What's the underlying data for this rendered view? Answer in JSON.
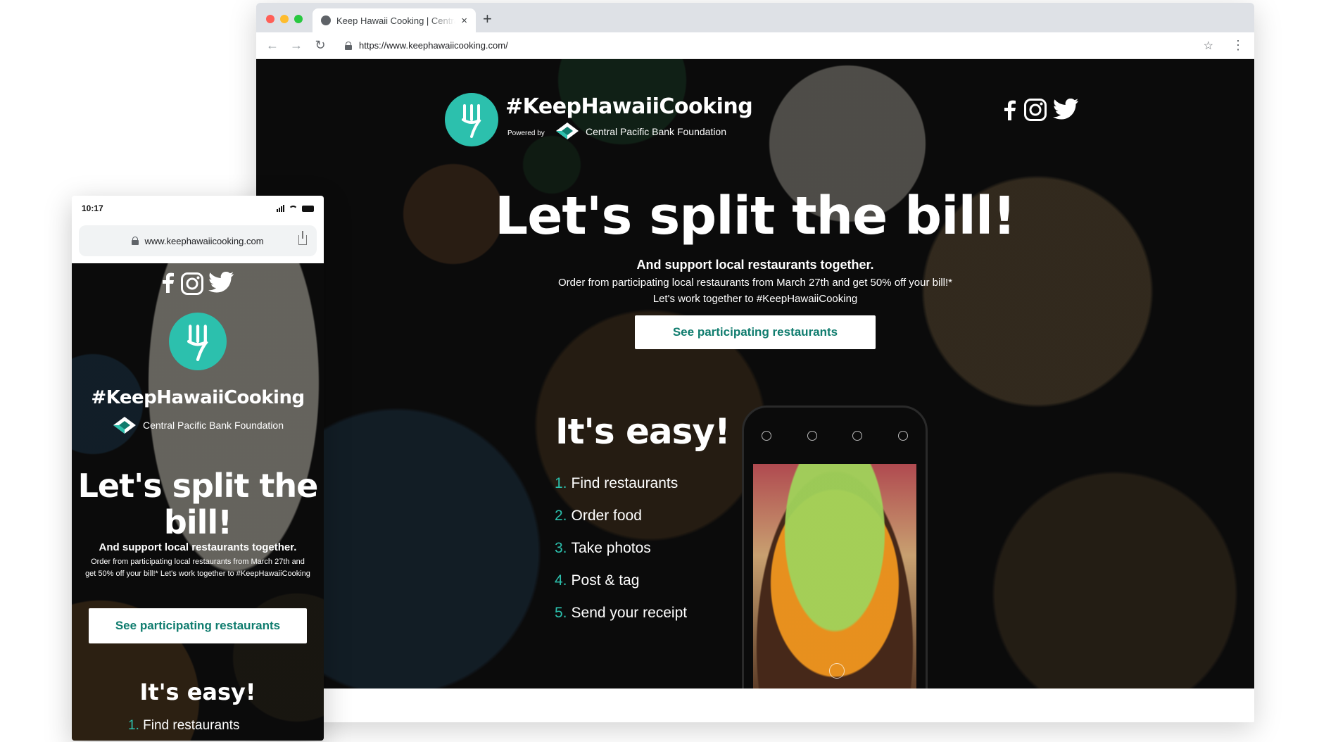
{
  "desktop": {
    "browser": {
      "tab_title": "Keep Hawaii Cooking | Central Pacific Bank Foundation",
      "tab_close": "×",
      "new_tab": "+",
      "back": "←",
      "forward": "→",
      "reload": "↻",
      "url": "https://www.keephawaiicooking.com/",
      "bookmark": "☆",
      "menu": "⋮"
    },
    "header": {
      "brand_title": "#KeepHawaiiCooking",
      "powered_by": "Powered by",
      "foundation": "Central Pacific Bank Foundation"
    },
    "hero": {
      "title": "Let's split the bill!",
      "subtitle": "And support local restaurants together.",
      "text": "Order from participating local restaurants from March 27th and get 50% off your bill!*  Let's work together to #KeepHawaiiCooking",
      "cta": "See participating restaurants"
    },
    "steps": {
      "title": "It's easy!",
      "items": [
        {
          "num": "1.",
          "label": "Find restaurants"
        },
        {
          "num": "2.",
          "label": "Order food"
        },
        {
          "num": "3.",
          "label": "Take photos"
        },
        {
          "num": "4.",
          "label": "Post & tag"
        },
        {
          "num": "5.",
          "label": "Send your receipt"
        }
      ]
    }
  },
  "mobile": {
    "time": "10:17",
    "url": "www.keephawaiicooking.com",
    "brand_title": "#KeepHawaiiCooking",
    "foundation": "Central Pacific Bank Foundation",
    "hero_title": "Let's split the bill!",
    "subtitle": "And support local restaurants together.",
    "text": "Order from participating local restaurants from March 27th and get 50% off your bill!*  Let's work together to #KeepHawaiiCooking",
    "cta": "See participating restaurants",
    "easy_title": "It's easy!",
    "first_step_num": "1.",
    "first_step": "Find restaurants"
  },
  "colors": {
    "brand_teal": "#2cc0ad",
    "cta_text": "#0f7c6e",
    "window_close": "#ff5f57",
    "window_minimize": "#febc2e",
    "window_maximize": "#28c840"
  },
  "icons": [
    "facebook-icon",
    "instagram-icon",
    "twitter-icon",
    "fork-logo-icon",
    "cpb-logo-icon",
    "lock-icon",
    "share-icon"
  ]
}
